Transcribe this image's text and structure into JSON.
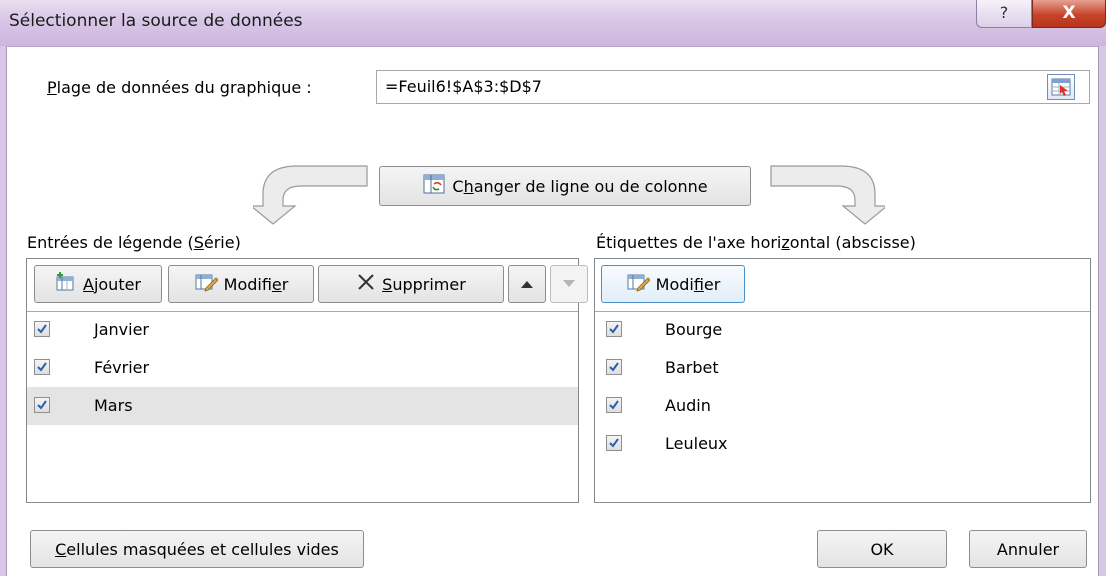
{
  "dialog": {
    "title": "Sélectionner la source de données",
    "help_glyph": "?",
    "close_glyph": "X"
  },
  "range": {
    "label_prefix_underlined": "P",
    "label_rest": "lage de données du graphique :",
    "value": "=Feuil6!$A$3:$D$7"
  },
  "switch_button": {
    "prefix": "C",
    "underlined": "h",
    "rest": "anger de ligne ou de colonne"
  },
  "legend_panel": {
    "heading_before": "Entrées de légende (",
    "heading_underlined": "S",
    "heading_after": "érie)",
    "add": {
      "underlined": "A",
      "rest": "jouter"
    },
    "edit": {
      "before": "Modifi",
      "underlined": "e",
      "after": "r"
    },
    "delete": {
      "underlined": "S",
      "rest": "upprimer"
    },
    "items": [
      {
        "label": "Janvier",
        "checked": true
      },
      {
        "label": "Février",
        "checked": true
      },
      {
        "label": "Mars",
        "checked": true,
        "selected": true
      }
    ]
  },
  "axis_panel": {
    "heading_before": "Étiquettes de l'axe hori",
    "heading_underlined": "z",
    "heading_after": "ontal (abscisse)",
    "edit": {
      "before": "Modi",
      "underlined": "f",
      "after": "ier"
    },
    "items": [
      {
        "label": "Bourge",
        "checked": true
      },
      {
        "label": "Barbet",
        "checked": true
      },
      {
        "label": "Audin",
        "checked": true
      },
      {
        "label": "Leuleux",
        "checked": true
      }
    ]
  },
  "footer": {
    "hidden_cells": {
      "underlined": "C",
      "rest": "ellules masquées et cellules vides"
    },
    "ok": "OK",
    "cancel": "Annuler"
  }
}
